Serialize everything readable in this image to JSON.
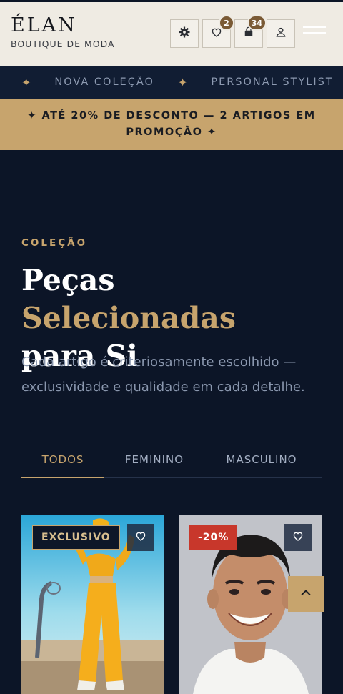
{
  "brand": {
    "name": "ÉLAN",
    "tagline": "BOUTIQUE DE MODA"
  },
  "header": {
    "wishlist_count": "2",
    "cart_count": "34"
  },
  "marquee": {
    "items": [
      "NOVA COLEÇÃO",
      "PERSONAL STYLIST"
    ]
  },
  "promo": {
    "text": "✦ ATÉ 20% DE DESCONTO — 2 ARTIGOS EM PROMOÇÃO ✦"
  },
  "hero": {
    "eyebrow": "COLEÇÃO",
    "title_part1": "Peças ",
    "title_accent": "Selecionadas",
    "title_part2": "para Si",
    "description": "Cada artigo é criteriosamente escolhido — exclusividade e qualidade em cada detalhe."
  },
  "tabs": [
    {
      "label": "TODOS",
      "active": true
    },
    {
      "label": "FEMININO",
      "active": false
    },
    {
      "label": "MASCULINO",
      "active": false
    }
  ],
  "products": [
    {
      "badge": "EXCLUSIVO"
    },
    {
      "badge": "-20%"
    }
  ],
  "colors": {
    "navy": "#0c1527",
    "gold": "#c7a46d",
    "cream": "#efebe3",
    "sale": "#c8372b"
  }
}
